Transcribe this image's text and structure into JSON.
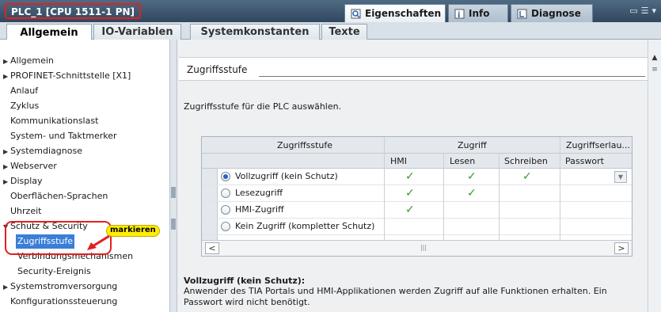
{
  "window": {
    "title": "PLC_1 [CPU 1511-1 PN]",
    "panel_tabs": [
      {
        "label": "Eigenschaften",
        "icon": "properties-icon",
        "active": true
      },
      {
        "label": "Info",
        "icon": "info-icon",
        "active": false
      },
      {
        "label": "Diagnose",
        "icon": "diagnostics-icon",
        "active": false
      }
    ]
  },
  "subtabs": [
    "Allgemein",
    "IO-Variablen",
    "Systemkonstanten",
    "Texte"
  ],
  "nav": {
    "items": [
      {
        "label": "Allgemein",
        "expandable": true
      },
      {
        "label": "PROFINET-Schnittstelle [X1]",
        "expandable": true
      },
      {
        "label": "Anlauf",
        "expandable": false
      },
      {
        "label": "Zyklus",
        "expandable": false
      },
      {
        "label": "Kommunikationslast",
        "expandable": false
      },
      {
        "label": "System- und Taktmerker",
        "expandable": false
      },
      {
        "label": "Systemdiagnose",
        "expandable": true
      },
      {
        "label": "Webserver",
        "expandable": true
      },
      {
        "label": "Display",
        "expandable": true
      },
      {
        "label": "Oberflächen-Sprachen",
        "expandable": false
      },
      {
        "label": "Uhrzeit",
        "expandable": false
      },
      {
        "label": "Schutz & Security",
        "expandable": true,
        "expanded": true
      },
      {
        "label": "Zugriffsstufe",
        "selected": true
      },
      {
        "label": "Verbindungsmechanismen"
      },
      {
        "label": "Security-Ereignis"
      },
      {
        "label": "Systemstromversorgung",
        "expandable": true
      },
      {
        "label": "Konfigurationssteuerung",
        "expandable": false
      }
    ],
    "annotation": "markieren"
  },
  "content": {
    "section_title": "Zugriffsstufe",
    "description": "Zugriffsstufe für die PLC auswählen.",
    "table": {
      "header_groups": [
        "Zugriffsstufe",
        "Zugriff",
        "Zugriffserlau..."
      ],
      "subheaders": [
        "HMI",
        "Lesen",
        "Schreiben",
        "Passwort"
      ],
      "rows": [
        {
          "label": "Vollzugriff (kein Schutz)",
          "selected": true,
          "hmi": true,
          "lesen": true,
          "schreiben": true
        },
        {
          "label": "Lesezugriff",
          "selected": false,
          "hmi": true,
          "lesen": true,
          "schreiben": false
        },
        {
          "label": "HMI-Zugriff",
          "selected": false,
          "hmi": true,
          "lesen": false,
          "schreiben": false
        },
        {
          "label": "Kein Zugriff (kompletter Schutz)",
          "selected": false,
          "hmi": false,
          "lesen": false,
          "schreiben": false
        }
      ],
      "check_glyph": "✓"
    },
    "note": {
      "title": "Vollzugriff (kein Schutz):",
      "text": "Anwender des TIA Portals und HMI-Applikationen werden Zugriff auf alle Funktionen erhalten. Ein Passwort wird nicht benötigt."
    }
  },
  "colors": {
    "titlebar": "#30475e",
    "highlight_red": "#e02020",
    "selection_blue": "#3a7ed8",
    "check_green": "#2e9a2e",
    "badge_yellow": "#ffee00"
  }
}
